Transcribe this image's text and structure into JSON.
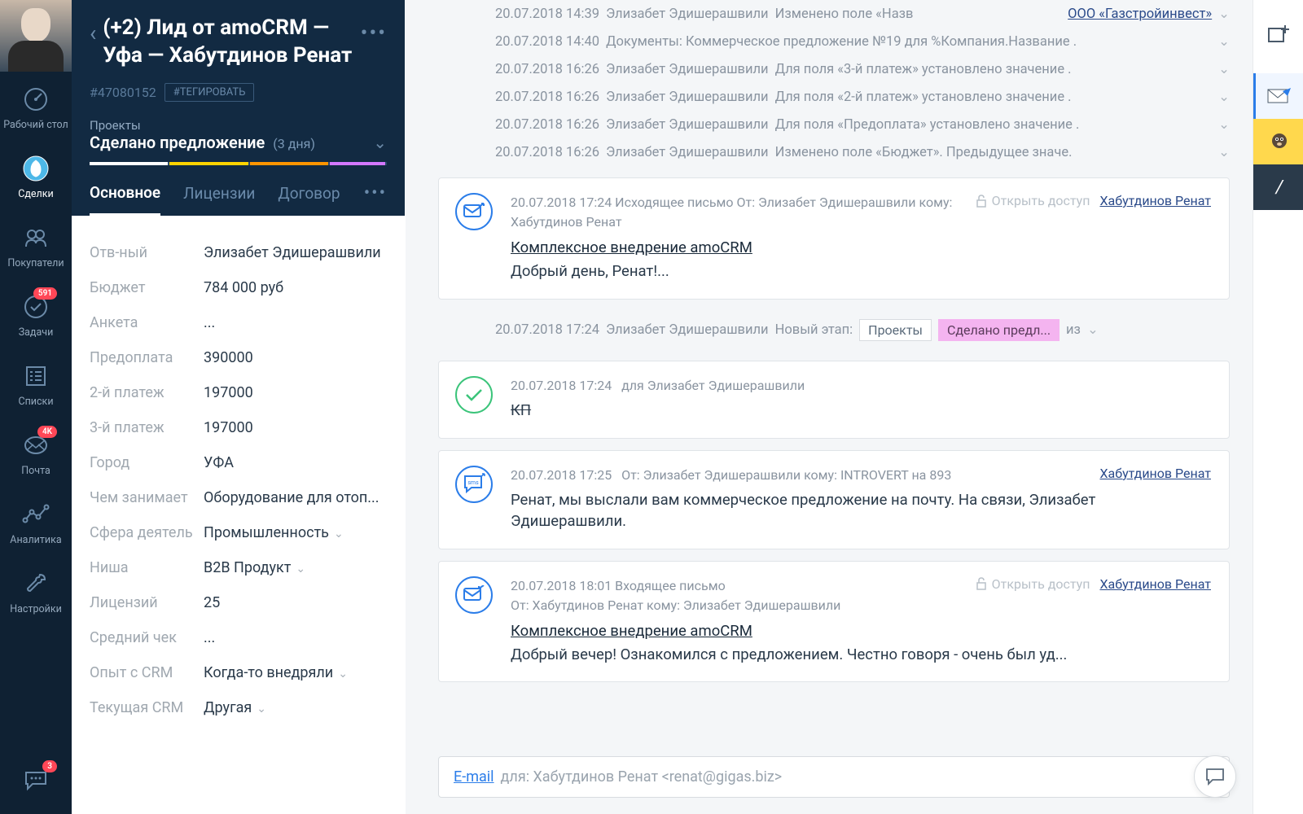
{
  "nav": {
    "items": [
      {
        "label": "Рабочий стол",
        "key": "dashboard"
      },
      {
        "label": "Сделки",
        "key": "deals",
        "active": true
      },
      {
        "label": "Покупатели",
        "key": "customers"
      },
      {
        "label": "Задачи",
        "key": "tasks",
        "badge": "591"
      },
      {
        "label": "Списки",
        "key": "lists"
      },
      {
        "label": "Почта",
        "key": "mail",
        "badge": "4K"
      },
      {
        "label": "Аналитика",
        "key": "analytics"
      },
      {
        "label": "Настройки",
        "key": "settings"
      }
    ],
    "chat_badge": "3"
  },
  "lead": {
    "title": "(+2) Лид от amoCRM — Уфа — Хабутдинов Ренат",
    "id": "#47080152",
    "tag_btn": "#ТЕГИРОВАТЬ",
    "pipeline_label": "Проекты",
    "stage": "Сделано предложение",
    "stage_days": "(3 дня)",
    "tabs": [
      {
        "label": "Основное",
        "key": "main",
        "active": true
      },
      {
        "label": "Лицензии",
        "key": "lic"
      },
      {
        "label": "Договор",
        "key": "contract"
      }
    ],
    "fields": [
      {
        "label": "Отв-ный",
        "value": "Элизабет Эдишерашвили"
      },
      {
        "label": "Бюджет",
        "value": "784 000 руб"
      },
      {
        "label": "Анкета",
        "value": "..."
      },
      {
        "label": "Предоплата",
        "value": "390000"
      },
      {
        "label": "2-й платеж",
        "value": "197000"
      },
      {
        "label": "3-й платеж",
        "value": "197000"
      },
      {
        "label": "Город",
        "value": "УФА"
      },
      {
        "label": "Чем занимает",
        "value": "Оборудование для отоп..."
      },
      {
        "label": "Сфера деятель",
        "value": "Промышленность",
        "dropdown": true
      },
      {
        "label": "Ниша",
        "value": "B2B Продукт",
        "dropdown": true
      },
      {
        "label": "Лицензий",
        "value": "25"
      },
      {
        "label": "Средний чек",
        "value": "..."
      },
      {
        "label": "Опыт с CRM",
        "value": "Когда-то внедряли",
        "dropdown": true
      },
      {
        "label": "Текущая CRM",
        "value": "Другая",
        "dropdown": true
      }
    ]
  },
  "feed": {
    "logs": [
      {
        "time": "20.07.2018 14:39",
        "user": "Элизабет Эдишерашвили",
        "text": "Изменено поле «Назв",
        "link": "ООО «Газстройинвест»"
      },
      {
        "time": "20.07.2018 14:40",
        "text": "Документы: Коммерческое предложение №19 для %Компания.Название ."
      },
      {
        "time": "20.07.2018 16:26",
        "user": "Элизабет Эдишерашвили",
        "text": "Для поля «3-й платеж» установлено значение ."
      },
      {
        "time": "20.07.2018 16:26",
        "user": "Элизабет Эдишерашвили",
        "text": "Для поля «2-й платеж» установлено значение ."
      },
      {
        "time": "20.07.2018 16:26",
        "user": "Элизабет Эдишерашвили",
        "text": "Для поля «Предоплата» установлено значение ."
      },
      {
        "time": "20.07.2018 16:26",
        "user": "Элизабет Эдишерашвили",
        "text": "Изменено поле «Бюджет». Предыдущее значе."
      }
    ],
    "email_out": {
      "time": "20.07.2018 17:24",
      "meta1": "Исходящее письмо От: Элизабет Эдишерашвили кому: Хабутдинов Ренат",
      "access": "Открыть доступ",
      "contact": "Хабутдинов Ренат",
      "subject": "Комплексное внедрение amoCRM",
      "body": "Добрый день, Ренат!..."
    },
    "stage_change": {
      "time": "20.07.2018 17:24",
      "user": "Элизабет Эдишерашвили",
      "label": "Новый этап:",
      "from": "Проекты",
      "to": "Сделано предл...",
      "suffix": "из"
    },
    "task": {
      "time": "20.07.2018 17:24",
      "for": "для Элизабет Эдишерашвили",
      "body": "КП"
    },
    "sms": {
      "time": "20.07.2018 17:25",
      "meta": "От: Элизабет Эдишерашвили кому: INTROVERT на 893",
      "contact": "Хабутдинов Ренат",
      "body": "Ренат, мы выслали вам коммерческое предложение на почту. На связи, Элизабет Эдишерашвили."
    },
    "email_in": {
      "time": "20.07.2018 18:01",
      "meta1": "Входящее письмо",
      "meta2": "От: Хабутдинов Ренат кому: Элизабет Эдишерашвили",
      "access": "Открыть доступ",
      "contact": "Хабутдинов Ренат",
      "subject": "Комплексное внедрение amoCRM",
      "body": "Добрый вечер! Ознакомился с предложением. Честно говоря - очень был уд..."
    },
    "compose": {
      "type": "E-mail",
      "to": "для: Хабутдинов Ренат <renat@gigas.biz>"
    }
  },
  "right_rail": {
    "slash": "/"
  }
}
